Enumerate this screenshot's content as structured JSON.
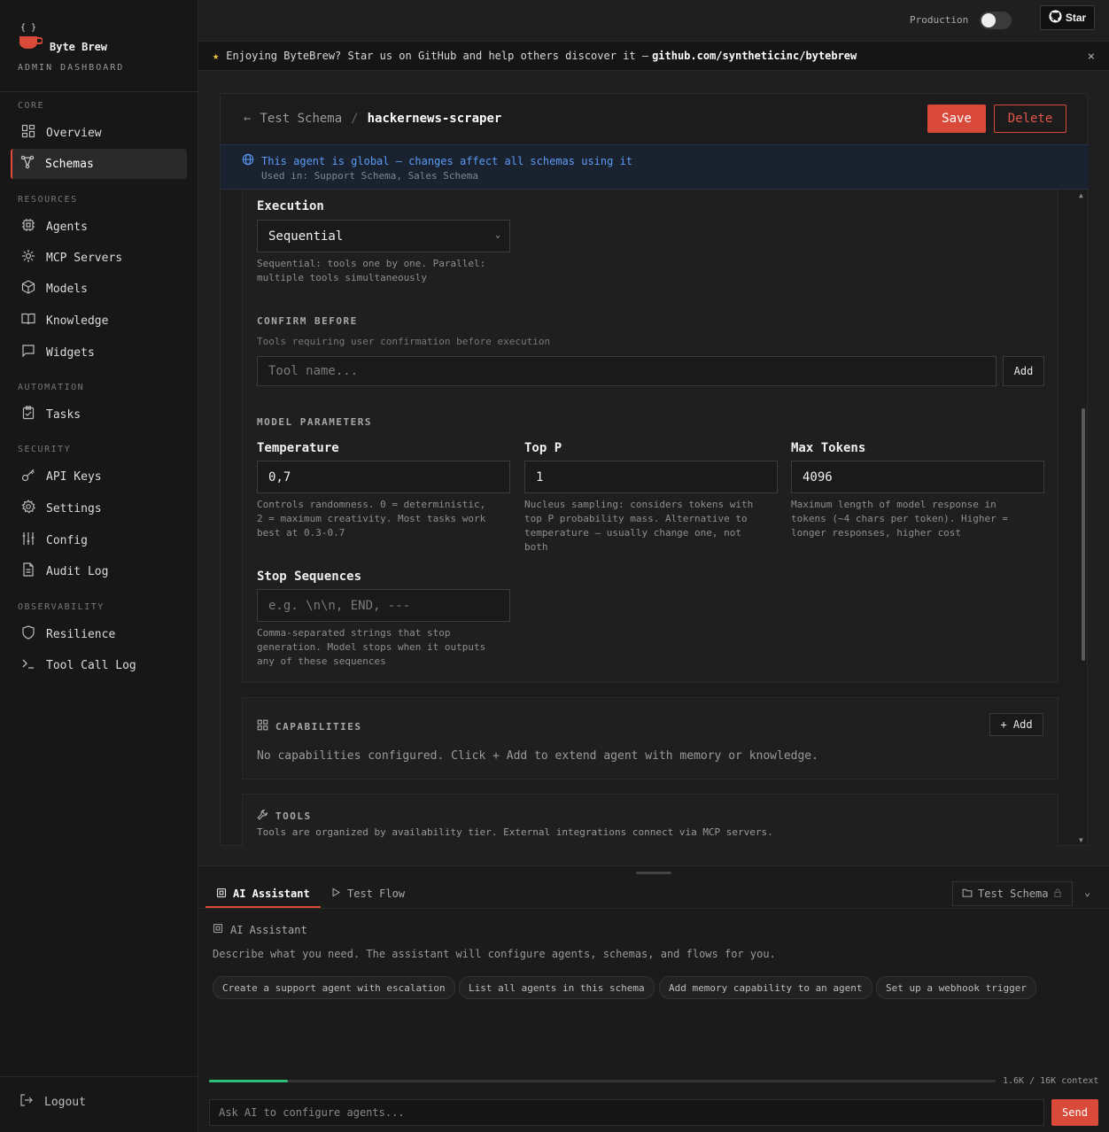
{
  "brand": {
    "name": "Byte Brew",
    "subtitle": "ADMIN DASHBOARD",
    "logo_mark": "{ }"
  },
  "sidebar": {
    "sections": [
      {
        "label": "CORE",
        "items": [
          {
            "label": "Overview",
            "icon": "grid-icon"
          },
          {
            "label": "Schemas",
            "icon": "schema-icon",
            "active": true
          }
        ]
      },
      {
        "label": "RESOURCES",
        "items": [
          {
            "label": "Agents",
            "icon": "cpu-icon"
          },
          {
            "label": "MCP Servers",
            "icon": "sun-icon"
          },
          {
            "label": "Models",
            "icon": "cube-icon"
          },
          {
            "label": "Knowledge",
            "icon": "book-icon"
          },
          {
            "label": "Widgets",
            "icon": "chat-icon"
          }
        ]
      },
      {
        "label": "AUTOMATION",
        "items": [
          {
            "label": "Tasks",
            "icon": "clipboard-icon"
          }
        ]
      },
      {
        "label": "SECURITY",
        "items": [
          {
            "label": "API Keys",
            "icon": "key-icon"
          },
          {
            "label": "Settings",
            "icon": "gear-icon"
          },
          {
            "label": "Config",
            "icon": "sliders-icon"
          },
          {
            "label": "Audit Log",
            "icon": "document-icon"
          }
        ]
      },
      {
        "label": "OBSERVABILITY",
        "items": [
          {
            "label": "Resilience",
            "icon": "shield-icon"
          },
          {
            "label": "Tool Call Log",
            "icon": "terminal-icon"
          }
        ]
      }
    ],
    "logout_label": "Logout"
  },
  "topbar": {
    "env_label": "Production",
    "star_label": "Star"
  },
  "banner": {
    "text": "Enjoying ByteBrew? Star us on GitHub and help others discover it —",
    "link": "github.com/syntheticinc/bytebrew",
    "close": "×"
  },
  "editor": {
    "breadcrumb_parent": "Test Schema",
    "breadcrumb_sep": "/",
    "breadcrumb_current": "hackernews-scraper",
    "save_label": "Save",
    "delete_label": "Delete",
    "global_note": "This agent is global — changes affect all schemas using it",
    "used_in": "Used in: Support Schema, Sales Schema"
  },
  "execution": {
    "label": "Execution",
    "value": "Sequential",
    "help_1": "Sequential: tools one by one. Parallel:",
    "help_2": "multiple tools simultaneously"
  },
  "confirm_before": {
    "title": "CONFIRM BEFORE",
    "help": "Tools requiring user confirmation before execution",
    "placeholder": "Tool name...",
    "add_label": "Add"
  },
  "model_params": {
    "title": "MODEL PARAMETERS",
    "temperature": {
      "label": "Temperature",
      "value": "0,7",
      "help": [
        "Controls randomness. 0 = deterministic,",
        "2 = maximum creativity. Most tasks work",
        "best at 0.3-0.7"
      ]
    },
    "top_p": {
      "label": "Top P",
      "value": "1",
      "help": [
        "Nucleus sampling: considers tokens with",
        "top P probability mass. Alternative to",
        "temperature — usually change one, not",
        "both"
      ]
    },
    "max_tokens": {
      "label": "Max Tokens",
      "value": "4096",
      "help": [
        "Maximum length of model response in",
        "tokens (~4 chars per token). Higher =",
        "longer responses, higher cost"
      ]
    },
    "stop_sequences": {
      "label": "Stop Sequences",
      "placeholder": "e.g. \\n\\n, END, ---",
      "help": [
        "Comma-separated strings that stop",
        "generation. Model stops when it outputs",
        "any of these sequences"
      ]
    }
  },
  "capabilities": {
    "title": "CAPABILITIES",
    "add_label": "+ Add",
    "empty": "No capabilities configured. Click + Add to extend agent with memory or knowledge."
  },
  "tools": {
    "title": "TOOLS",
    "help": "Tools are organized by availability tier. External integrations connect via MCP servers."
  },
  "assistant": {
    "tab_ai": "AI Assistant",
    "tab_flow": "Test Flow",
    "schema_pill": "Test Schema",
    "title": "AI Assistant",
    "description": "Describe what you need. The assistant will configure agents, schemas, and flows for you.",
    "suggestions": [
      "Create a support agent with escalation",
      "List all agents in this schema",
      "Add memory capability to an agent",
      "Set up a webhook trigger"
    ],
    "context_used_fraction": 0.1,
    "context_label": "1.6K / 16K context",
    "input_placeholder": "Ask AI to configure agents...",
    "send_label": "Send"
  },
  "colors": {
    "accent": "#d94a3a",
    "info": "#5b9bf5",
    "progress": "#2ec07a"
  }
}
